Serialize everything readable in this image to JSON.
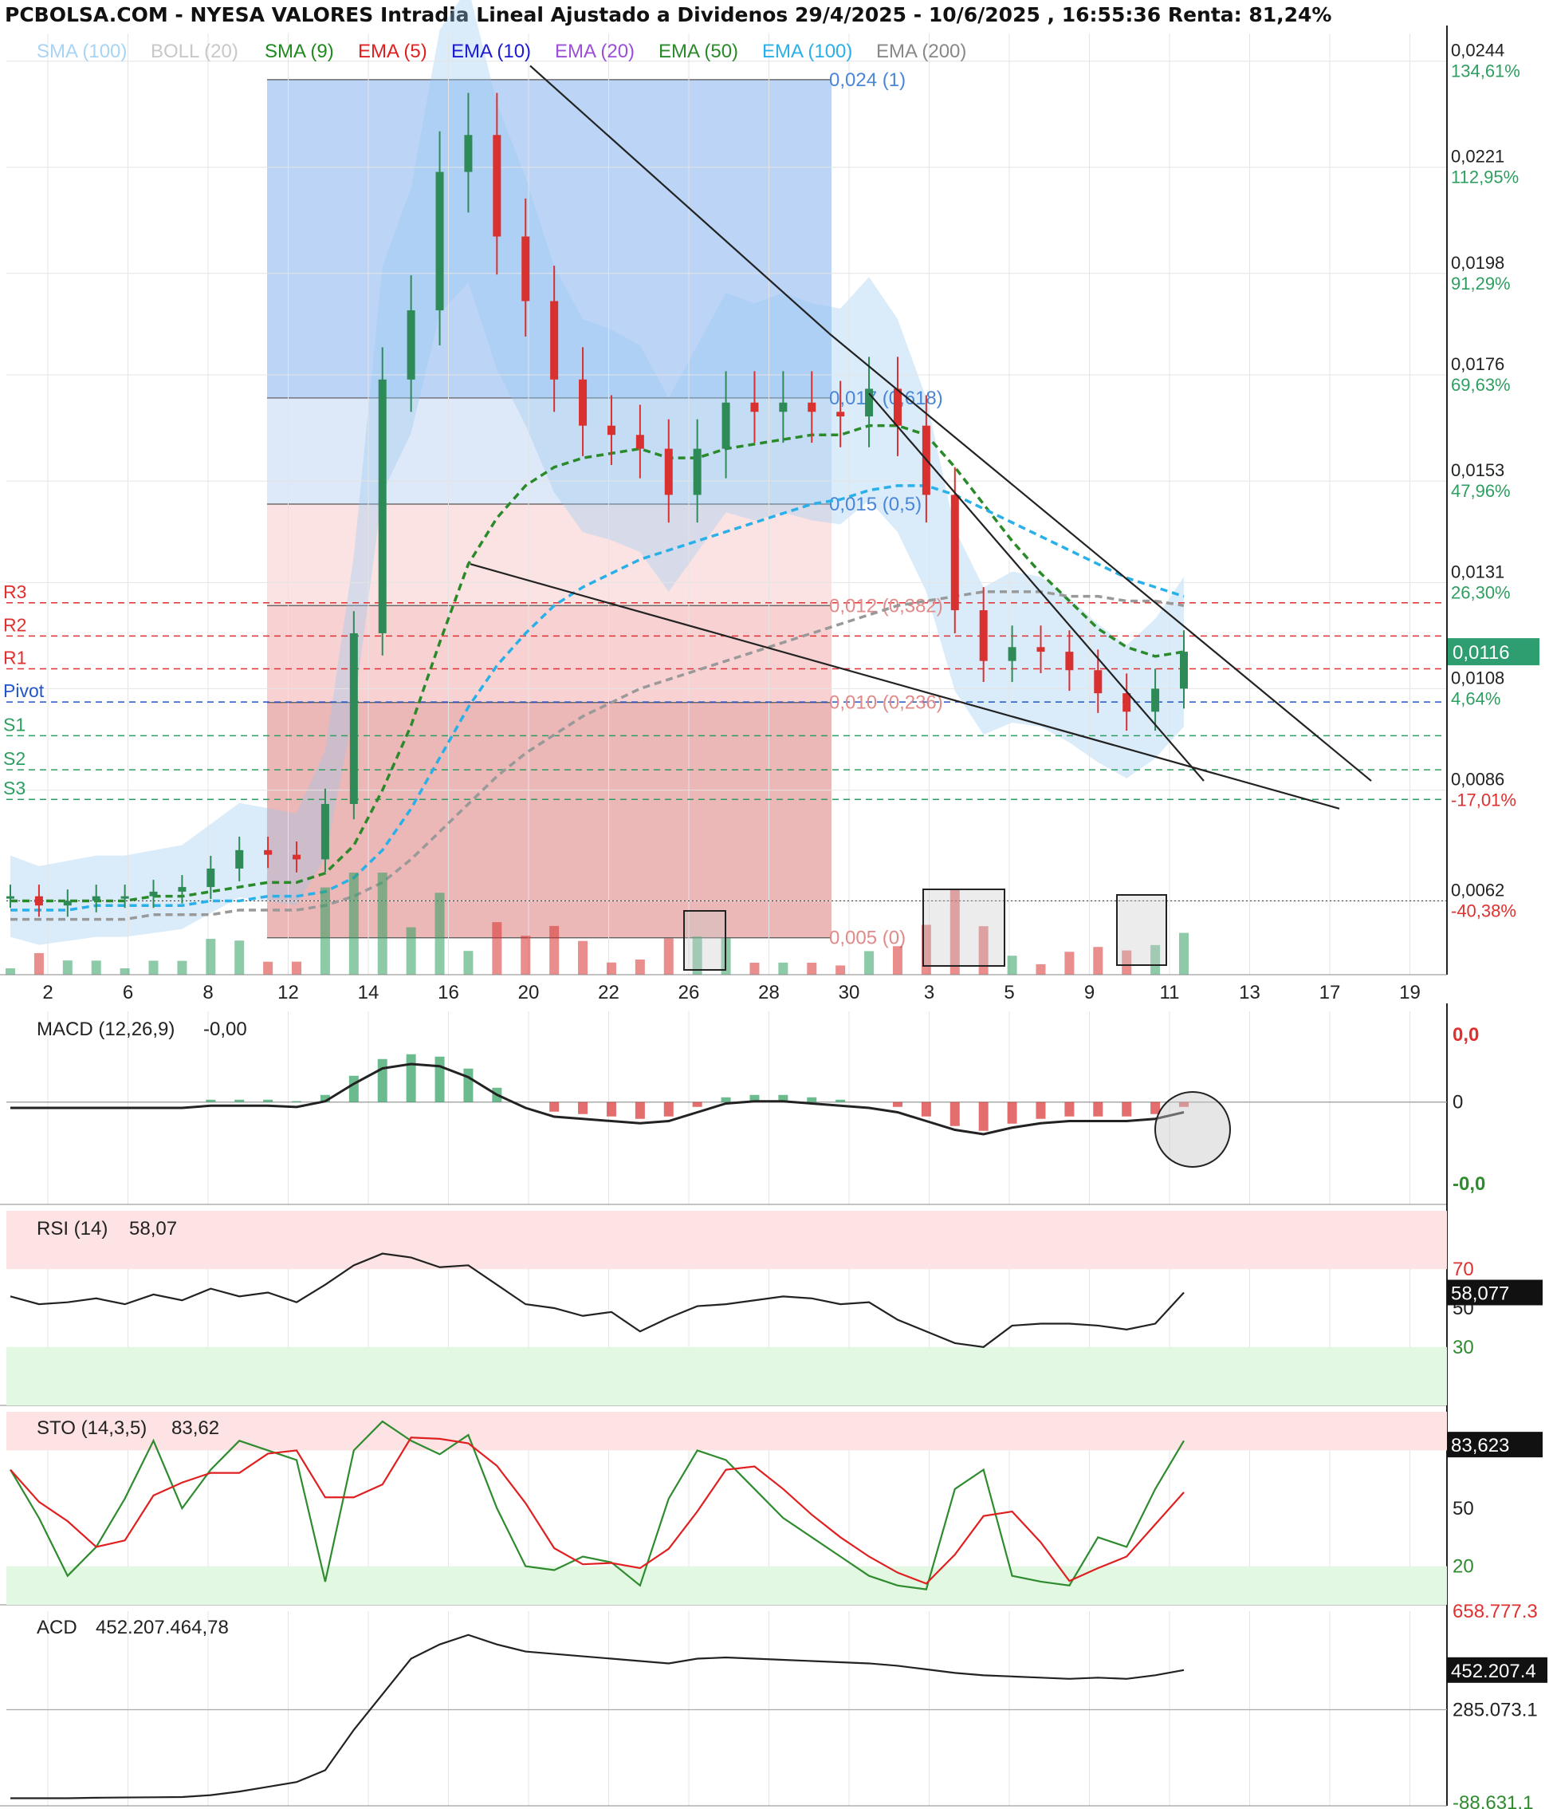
{
  "header": {
    "title": "PCBOLSA.COM - NYESA VALORES Intradia Lineal Ajustado a Dividenos 29/4/2025 - 10/6/2025 , 16:55:36 Renta: 81,24%"
  },
  "legend": [
    {
      "label": "SMA (100)",
      "color": "#a8d4f4"
    },
    {
      "label": "BOLL (20)",
      "color": "#c8c8c8"
    },
    {
      "label": "SMA (9)",
      "color": "#1f8a1f"
    },
    {
      "label": "EMA (5)",
      "color": "#e02020"
    },
    {
      "label": "EMA (10)",
      "color": "#1a1ad0"
    },
    {
      "label": "EMA (20)",
      "color": "#9b4fd8"
    },
    {
      "label": "EMA (50)",
      "color": "#2a8a2a"
    },
    {
      "label": "EMA (100)",
      "color": "#2ab0e8"
    },
    {
      "label": "EMA (200)",
      "color": "#888888"
    }
  ],
  "colors": {
    "up": "#2e8b57",
    "down": "#d93030",
    "accent": "#2e9e70"
  },
  "chart_data": [
    {
      "type": "candlestick",
      "panel": "price",
      "x_ticks": [
        "2",
        "6",
        "8",
        "12",
        "14",
        "16",
        "20",
        "22",
        "26",
        "28",
        "30",
        "3",
        "5",
        "9",
        "11",
        "13",
        "17",
        "19"
      ],
      "y_ticks": [
        {
          "price": "0,0244",
          "pct": "134,61%"
        },
        {
          "price": "0,0221",
          "pct": "112,95%"
        },
        {
          "price": "0,0198",
          "pct": "91,29%"
        },
        {
          "price": "0,0176",
          "pct": "69,63%"
        },
        {
          "price": "0,0153",
          "pct": "47,96%"
        },
        {
          "price": "0,0131",
          "pct": "26,30%"
        },
        {
          "price": "0,0108",
          "pct": "4,64%"
        },
        {
          "price": "0,0086",
          "pct": "-17,01%"
        },
        {
          "price": "0,0062",
          "pct": "-40,38%"
        }
      ],
      "ylim": [
        0.0046,
        0.025
      ],
      "last_price": "0,0116",
      "pivots": [
        {
          "label": "R3",
          "value": 0.01266
        },
        {
          "label": "R2",
          "value": 0.01194
        },
        {
          "label": "R1",
          "value": 0.01123
        },
        {
          "label": "Pivot",
          "value": 0.01051
        },
        {
          "label": "S1",
          "value": 0.00978
        },
        {
          "label": "S2",
          "value": 0.00904
        },
        {
          "label": "S3",
          "value": 0.0084
        }
      ],
      "fib_levels": [
        {
          "label": "0,024 (1)",
          "value": 0.024
        },
        {
          "label": "0,017 (0,618)",
          "value": 0.0171
        },
        {
          "label": "0,015 (0,5)",
          "value": 0.0148
        },
        {
          "label": "0,012 (0,382)",
          "value": 0.0126
        },
        {
          "label": "0,010 (0,236)",
          "value": 0.0105
        },
        {
          "label": "0,005 (0)",
          "value": 0.0054
        }
      ],
      "series": [
        {
          "name": "Precio",
          "values": [
            0.0063,
            0.0061,
            0.0062,
            0.0063,
            0.0063,
            0.0064,
            0.0065,
            0.0069,
            0.0073,
            0.0072,
            0.0071,
            0.0083,
            0.012,
            0.0175,
            0.019,
            0.022,
            0.0228,
            0.0206,
            0.0192,
            0.0175,
            0.0165,
            0.0163,
            0.016,
            0.015,
            0.016,
            0.017,
            0.0168,
            0.017,
            0.0168,
            0.0167,
            0.0173,
            0.0165,
            0.015,
            0.0125,
            0.0114,
            0.0117,
            0.0116,
            0.0112,
            0.0107,
            0.0103,
            0.0108,
            0.0116
          ]
        },
        {
          "name": "EMA (50)",
          "values": [
            0.0062,
            0.0062,
            0.0062,
            0.0062,
            0.0062,
            0.0063,
            0.0063,
            0.0064,
            0.0065,
            0.0066,
            0.0066,
            0.0068,
            0.0074,
            0.0086,
            0.01,
            0.0118,
            0.0135,
            0.0145,
            0.0152,
            0.0156,
            0.0158,
            0.0159,
            0.016,
            0.0158,
            0.0158,
            0.016,
            0.0161,
            0.0162,
            0.0163,
            0.0163,
            0.0165,
            0.0165,
            0.0163,
            0.0156,
            0.0148,
            0.014,
            0.0133,
            0.0127,
            0.0121,
            0.0117,
            0.0115,
            0.0116
          ]
        },
        {
          "name": "EMA (100)",
          "values": [
            0.006,
            0.006,
            0.006,
            0.0061,
            0.0061,
            0.0061,
            0.0061,
            0.0062,
            0.0062,
            0.0063,
            0.0063,
            0.0064,
            0.0067,
            0.0073,
            0.0082,
            0.0093,
            0.0104,
            0.0113,
            0.012,
            0.0126,
            0.013,
            0.0133,
            0.0136,
            0.0138,
            0.014,
            0.0142,
            0.0144,
            0.0146,
            0.0148,
            0.0149,
            0.0151,
            0.0152,
            0.0152,
            0.015,
            0.0147,
            0.0144,
            0.0141,
            0.0138,
            0.0135,
            0.0132,
            0.013,
            0.0128
          ]
        },
        {
          "name": "EMA (200)",
          "values": [
            0.0058,
            0.0058,
            0.0058,
            0.0058,
            0.0058,
            0.0059,
            0.0059,
            0.0059,
            0.006,
            0.006,
            0.006,
            0.0061,
            0.0063,
            0.0066,
            0.0071,
            0.0077,
            0.0083,
            0.0089,
            0.0094,
            0.0098,
            0.0102,
            0.0105,
            0.0108,
            0.011,
            0.0112,
            0.0114,
            0.0116,
            0.0118,
            0.012,
            0.0122,
            0.0124,
            0.0126,
            0.0127,
            0.0128,
            0.0129,
            0.0129,
            0.0129,
            0.0128,
            0.0128,
            0.0127,
            0.0127,
            0.0126
          ]
        }
      ]
    },
    {
      "type": "line",
      "panel": "MACD",
      "title": "MACD (12,26,9)",
      "value": "-0,00",
      "y_ticks": [
        "0,0",
        "0",
        "-0,0"
      ],
      "series": [
        {
          "name": "MACD",
          "values": [
            0,
            0,
            0,
            0,
            0,
            0,
            0,
            0.05,
            0.05,
            0.05,
            0.02,
            0.15,
            0.55,
            0.9,
            1.0,
            0.95,
            0.7,
            0.3,
            0.0,
            -0.2,
            -0.25,
            -0.3,
            -0.35,
            -0.3,
            -0.1,
            0.1,
            0.15,
            0.15,
            0.1,
            0.05,
            0.0,
            -0.1,
            -0.3,
            -0.5,
            -0.6,
            -0.45,
            -0.35,
            -0.3,
            -0.3,
            -0.3,
            -0.25,
            -0.1
          ]
        }
      ]
    },
    {
      "type": "line",
      "panel": "RSI",
      "title": "RSI (14)",
      "value": "58,07",
      "last": "58,077",
      "y_ticks": [
        "70",
        "50",
        "30"
      ],
      "ylim": [
        0,
        100
      ],
      "series": [
        {
          "name": "RSI",
          "values": [
            56,
            52,
            53,
            55,
            52,
            57,
            54,
            60,
            56,
            58,
            53,
            62,
            72,
            78,
            76,
            71,
            72,
            62,
            52,
            50,
            46,
            48,
            38,
            45,
            51,
            52,
            54,
            56,
            55,
            52,
            53,
            44,
            38,
            32,
            30,
            41,
            42,
            42,
            41,
            39,
            42,
            58
          ]
        }
      ]
    },
    {
      "type": "line",
      "panel": "STO",
      "title": "STO (14,3,5)",
      "value": "83,62",
      "last": "83,623",
      "y_ticks": [
        "50",
        "20"
      ],
      "ylim": [
        0,
        100
      ],
      "series": [
        {
          "name": "%K",
          "values": [
            70,
            45,
            15,
            30,
            55,
            85,
            50,
            70,
            85,
            80,
            75,
            12,
            80,
            95,
            85,
            78,
            88,
            50,
            20,
            18,
            25,
            22,
            10,
            55,
            80,
            75,
            60,
            45,
            35,
            25,
            15,
            10,
            8,
            60,
            70,
            15,
            12,
            10,
            35,
            30,
            60,
            85
          ]
        }
      ]
    },
    {
      "type": "line",
      "panel": "ACD",
      "title": "ACD",
      "value": "452.207.464,78",
      "last": "452.207.4",
      "y_ticks": [
        "658.777.3",
        "285.073.1",
        "-88.631.1"
      ],
      "series": [
        {
          "name": "ACD",
          "values": [
            -88,
            -88,
            -88,
            -86,
            -85,
            -84,
            -83,
            -75,
            -60,
            -40,
            -20,
            30,
            200,
            350,
            500,
            560,
            600,
            560,
            530,
            520,
            510,
            500,
            490,
            480,
            500,
            505,
            500,
            495,
            490,
            485,
            480,
            470,
            455,
            440,
            430,
            425,
            420,
            415,
            420,
            415,
            430,
            452
          ]
        }
      ]
    }
  ]
}
